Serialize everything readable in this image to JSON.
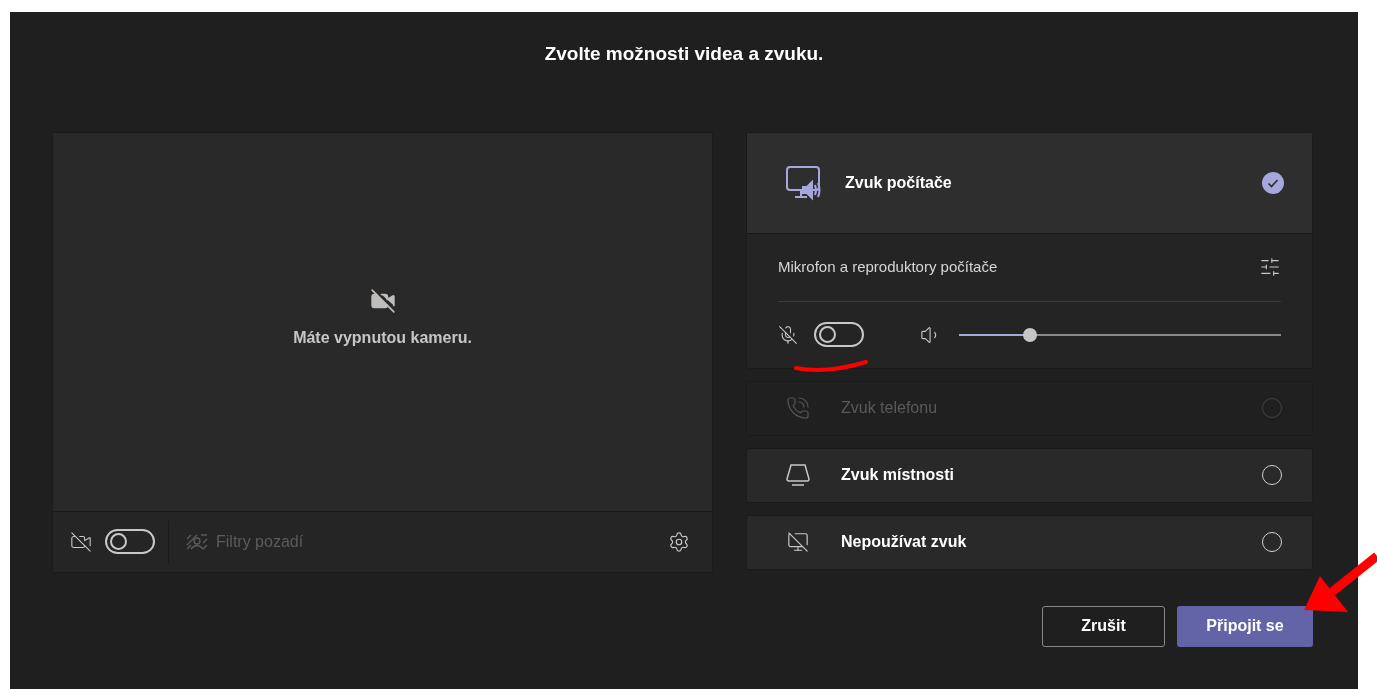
{
  "title": "Zvolte možnosti videa a zvuku.",
  "video": {
    "camera_on": false,
    "message": "Máte vypnutou kameru.",
    "background_filters": {
      "label": "Filtry pozadí",
      "disabled": true
    }
  },
  "audio_options": [
    {
      "kind": "computer",
      "label": "Zvuk počítače",
      "selected": true,
      "disabled": false,
      "device": "Mikrofon a reproduktory počítače",
      "mic_on": false,
      "volume": {
        "level": 0.22
      }
    },
    {
      "kind": "phone",
      "label": "Zvuk telefonu",
      "selected": false,
      "disabled": true
    },
    {
      "kind": "room",
      "label": "Zvuk místnosti",
      "selected": false,
      "disabled": false
    },
    {
      "kind": "none",
      "label": "Nepoužívat zvuk",
      "selected": false,
      "disabled": false
    }
  ],
  "buttons": [
    {
      "label": "Zrušit",
      "kind": "secondary"
    },
    {
      "label": "Připojit se",
      "kind": "primary"
    }
  ]
}
